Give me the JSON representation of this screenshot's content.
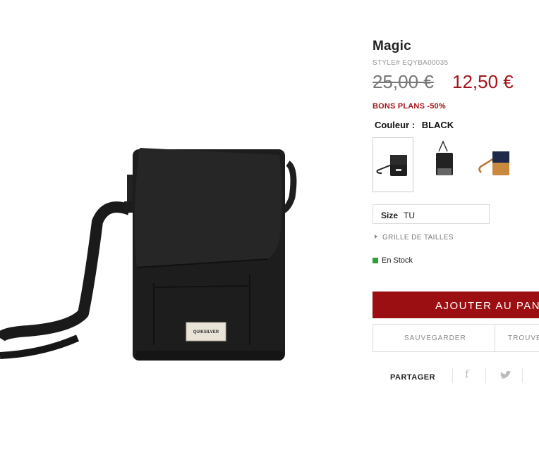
{
  "product": {
    "title": "Magic",
    "style": "STYLE# EQYBA00035",
    "price_old": "25,00 €",
    "price_new": "12,50 €",
    "promo": "BONS PLANS -50%",
    "color_label": "Couleur :",
    "color_value": "BLACK",
    "brand_on_label": "QUIKSILVER"
  },
  "swatches": [
    {
      "name": "black-bag",
      "selected": true
    },
    {
      "name": "black-grey-bag",
      "selected": false
    },
    {
      "name": "navy-tan-bag",
      "selected": false
    }
  ],
  "size": {
    "label": "Size",
    "value": "TU"
  },
  "size_guide": "GRILLE DE TAILLES",
  "stock": "En Stock",
  "buttons": {
    "add_to_cart": "AJOUTER AU PANIER",
    "save": "SAUVEGARDER",
    "find": "TROUVER"
  },
  "share": {
    "label": "PARTAGER",
    "facebook_icon": "f",
    "twitter_icon": "twitter-bird-icon"
  },
  "colors": {
    "accent": "#9b0f12",
    "price_red": "#a4141a",
    "stock_green": "#2e9d3a"
  }
}
